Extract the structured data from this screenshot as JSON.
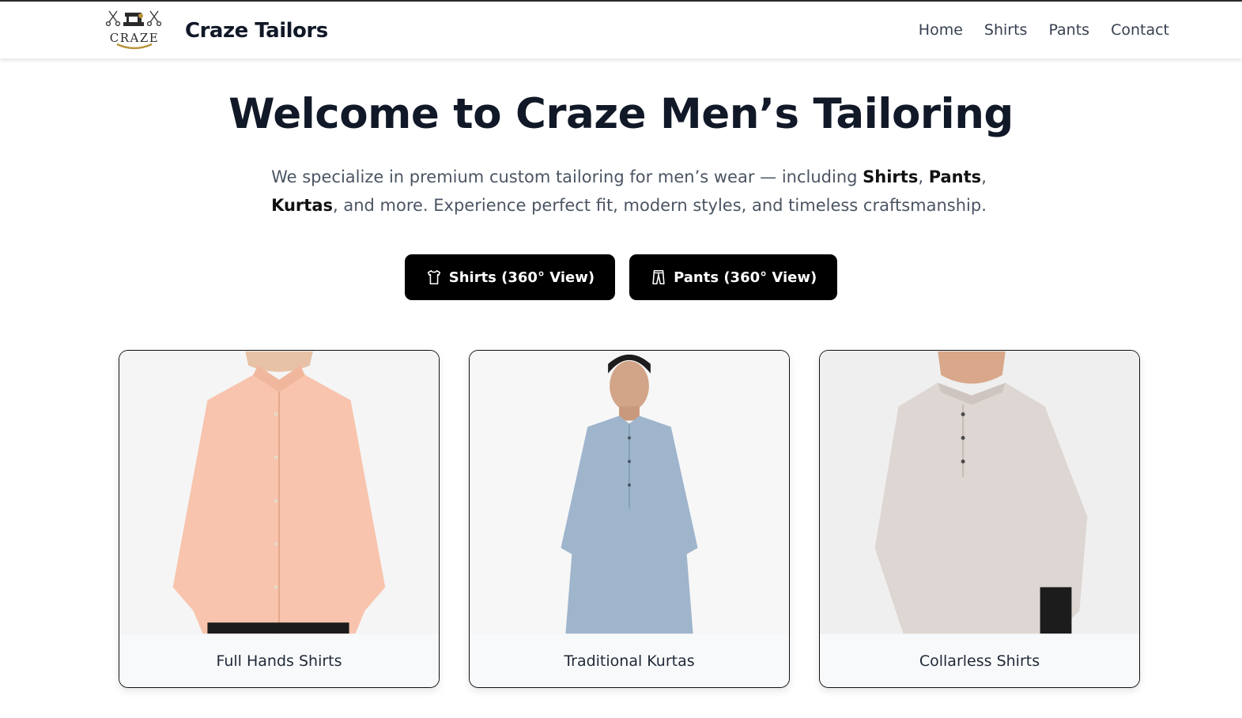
{
  "header": {
    "logo_text": "CRAZE",
    "brand": "Craze Tailors",
    "nav": [
      "Home",
      "Shirts",
      "Pants",
      "Contact"
    ]
  },
  "hero": {
    "title": "Welcome to Craze Men’s Tailoring",
    "subtitle": {
      "intro": "We specialize in premium custom tailoring for men’s wear — including ",
      "item1": "Shirts",
      "sep1": ", ",
      "item2": "Pants",
      "sep2": ", ",
      "item3": "Kurtas",
      "outro": ", and more. Experience perfect fit, modern styles, and timeless craftsmanship."
    },
    "buttons": [
      {
        "label": "Shirts (360° View)",
        "icon": "shirt-icon"
      },
      {
        "label": "Pants (360° View)",
        "icon": "pants-icon"
      }
    ]
  },
  "cards": [
    {
      "label": "Full Hands Shirts",
      "color": "#f8c4ad"
    },
    {
      "label": "Traditional Kurtas",
      "color": "#9fb5cc"
    },
    {
      "label": "Collarless Shirts",
      "color": "#ddd6d2"
    }
  ],
  "colors": {
    "primary_button": "#000000",
    "title": "#111827",
    "subtitle": "#4b5563"
  }
}
